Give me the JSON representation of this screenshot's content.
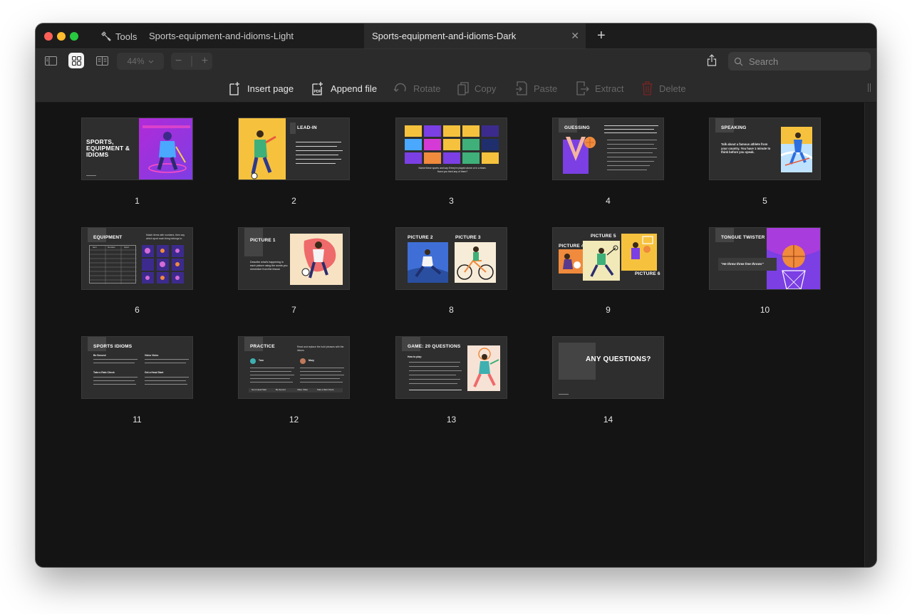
{
  "window": {
    "tools_label": "Tools",
    "tabs": [
      {
        "label": "Sports-equipment-and-idioms-Light",
        "active": false
      },
      {
        "label": "Sports-equipment-and-idioms-Dark",
        "active": true
      }
    ],
    "close_symbol": "✕",
    "new_tab_symbol": "+"
  },
  "toolbar": {
    "zoom": "44%",
    "zoom_out": "−",
    "zoom_in": "+",
    "search_placeholder": "Search"
  },
  "actions": [
    {
      "label": "Insert page",
      "icon": "insert-page-icon",
      "enabled": true
    },
    {
      "label": "Append file",
      "icon": "append-file-icon",
      "enabled": true
    },
    {
      "label": "Rotate",
      "icon": "rotate-icon",
      "enabled": false
    },
    {
      "label": "Copy",
      "icon": "copy-icon",
      "enabled": false
    },
    {
      "label": "Paste",
      "icon": "paste-icon",
      "enabled": false
    },
    {
      "label": "Extract",
      "icon": "extract-icon",
      "enabled": false
    },
    {
      "label": "Delete",
      "icon": "delete-icon",
      "enabled": false
    }
  ],
  "pages": [
    {
      "number": "1",
      "title": "SPORTS, EQUIPMENT & IDIOMS"
    },
    {
      "number": "2",
      "title": "LEAD-IN"
    },
    {
      "number": "3",
      "title": "",
      "caption": "Name these sports and say if they're played alone or in a team. Have you tried any of them?"
    },
    {
      "number": "4",
      "title": "GUESSING"
    },
    {
      "number": "5",
      "title": "SPEAKING",
      "caption": "Talk about a famous athlete from your country. You have 1 minute to think before you speak."
    },
    {
      "number": "6",
      "title": "EQUIPMENT",
      "caption": "Match items with numbers, then say which sport each thing belongs to",
      "table_headers": [
        "Item",
        "Number",
        "Sport"
      ]
    },
    {
      "number": "7",
      "title": "PICTURE 1",
      "caption": "Describe what's happening in each picture using the words you remember from the lesson"
    },
    {
      "number": "8",
      "title": "PICTURE 2",
      "title2": "PICTURE 3"
    },
    {
      "number": "9",
      "title": "PICTURE 5",
      "title2": "PICTURE 4",
      "title3": "PICTURE 6"
    },
    {
      "number": "10",
      "title": "TONGUE TWISTER",
      "caption": "\"He threw three free throws\""
    },
    {
      "number": "11",
      "title": "SPORTS IDIOMS",
      "items": [
        "Be Second",
        "Video Video",
        "Take a Rain Check",
        "Get a Head Start"
      ]
    },
    {
      "number": "12",
      "title": "PRACTICE",
      "caption": "Read and replace the bold phrases with the idioms",
      "names": [
        "Tom",
        "Mary"
      ],
      "items": [
        "Get a Head Start",
        "Be Second",
        "Video Video",
        "Take a Rain Check"
      ]
    },
    {
      "number": "13",
      "title": "GAME: 20 QUESTIONS",
      "caption": "How to play:"
    },
    {
      "number": "14",
      "title": "ANY QUESTIONS?"
    }
  ],
  "colors": {
    "purple": "#7b3fe4",
    "magenta": "#d63ad6",
    "yellow": "#f6c23e",
    "orange": "#f08a3c",
    "slide_bg": "#2e2e2e"
  }
}
